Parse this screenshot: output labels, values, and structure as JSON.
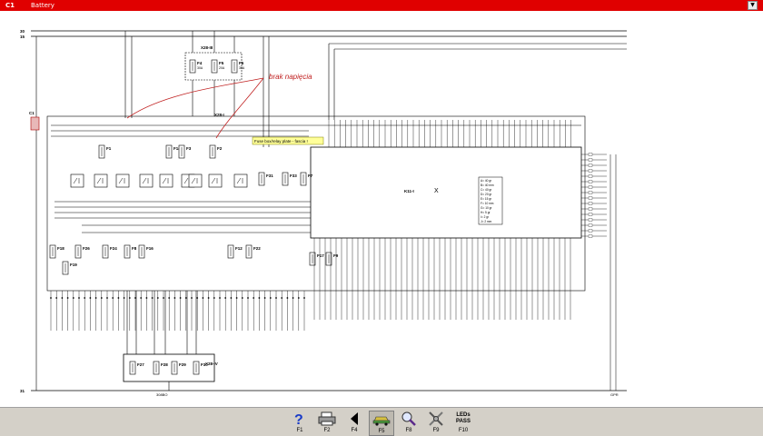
{
  "window": {
    "code": "C1",
    "title": "Battery",
    "dropdown_glyph": "▼"
  },
  "diagram": {
    "rail_top": "30",
    "rail_second": "15",
    "rail_bottom": "31",
    "relay_top": "X28-III",
    "relay_mid": "X28-I",
    "relay_bottom": "X28-IV",
    "module": "K11-I",
    "connector_left": "C1",
    "annotation": "brak napięcia",
    "tooltip": "Fuse box/relay plate - fascia !",
    "footer_left": "308BO",
    "footer_right": "GPR",
    "fuses_top": [
      "F4",
      "F5",
      "F6"
    ],
    "fuses_top_rating": [
      "30A",
      "20A",
      "30A"
    ],
    "fuses_a": [
      "F1",
      "F14",
      "F3",
      "F2"
    ],
    "fuses_b": [
      "F31",
      "F33",
      "F7"
    ],
    "fuses_c": [
      "F18",
      "F26",
      "F24",
      "F8",
      "F16",
      "F12",
      "F22"
    ],
    "fuses_d": [
      "F19",
      "F17",
      "F9"
    ],
    "fuses_bottom": [
      "F27",
      "F28",
      "F29",
      "F30"
    ],
    "legend_lines": [
      "A= 40 gr",
      "B= 40 mm",
      "C= 40 gr",
      "D= 20 gr",
      "E= 15 gr",
      "F= 10 mm",
      "G= 10 gr",
      "H= 5 gr",
      "I= 2 gr",
      "J= 2 mm"
    ]
  },
  "toolbar": {
    "buttons": [
      {
        "key": "F1",
        "icon": "help-icon"
      },
      {
        "key": "F2",
        "icon": "printer-icon"
      },
      {
        "key": "F4",
        "icon": "back-arrow-icon"
      },
      {
        "key": "F5",
        "icon": "car-icon"
      },
      {
        "key": "F8",
        "icon": "zoom-icon"
      },
      {
        "key": "F9",
        "icon": "tools-icon"
      },
      {
        "key": "F10",
        "icon": "led-pass-icon",
        "label_top": "LEDs",
        "label_bottom": "PASS"
      }
    ]
  }
}
